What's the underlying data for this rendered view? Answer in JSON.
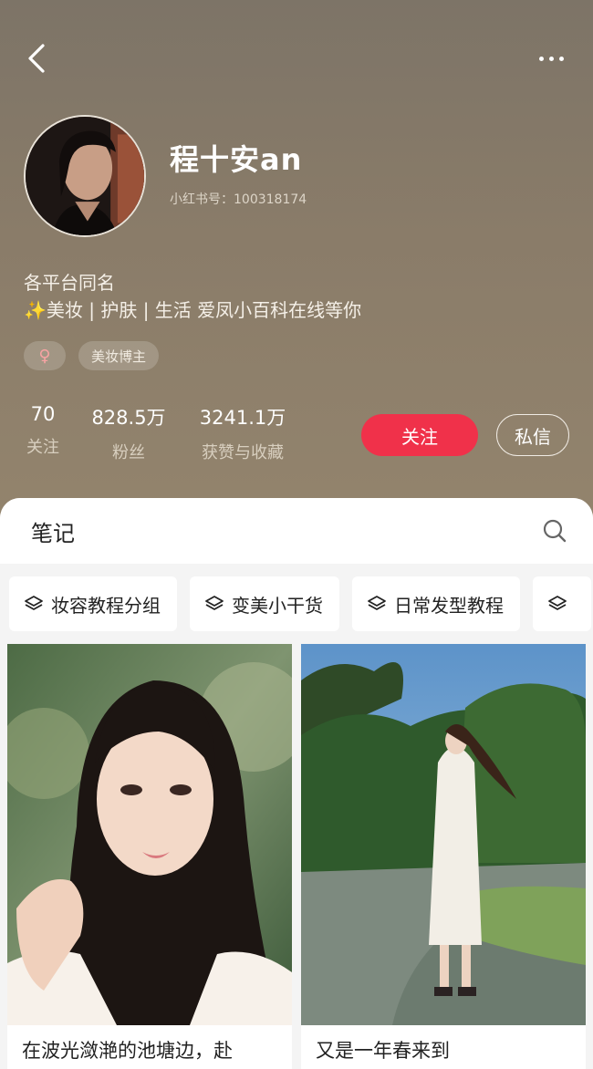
{
  "profile": {
    "name": "程十安an",
    "uid": "小红书号：100318174",
    "bio_line1": "各平台同名",
    "bio_line2": "✨美妆 | 护肤 | 生活 爱凤小百科在线等你",
    "gender_symbol": "♀",
    "tag": "美妆博主"
  },
  "stats": [
    {
      "value": "70",
      "label": "关注"
    },
    {
      "value": "828.5万",
      "label": "粉丝"
    },
    {
      "value": "3241.1万",
      "label": "获赞与收藏"
    }
  ],
  "actions": {
    "follow": "关注",
    "message": "私信"
  },
  "tabs": {
    "notes": "笔记"
  },
  "chips": [
    "妆容教程分组",
    "变美小干货",
    "日常发型教程",
    ""
  ],
  "cards": [
    {
      "caption": "在波光潋滟的池塘边，赴"
    },
    {
      "caption": "又是一年春来到"
    }
  ],
  "colors": {
    "header_bg": "#8a7c69",
    "accent": "#f0314a"
  }
}
